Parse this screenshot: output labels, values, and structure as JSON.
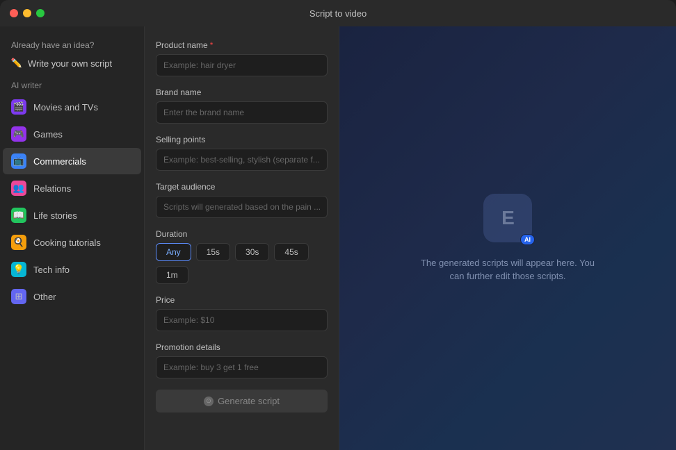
{
  "titlebar": {
    "title": "Script to video"
  },
  "sidebar": {
    "already_have_idea": "Already have an idea?",
    "write_btn_label": "Write your own script",
    "ai_writer_label": "AI writer",
    "items": [
      {
        "id": "movies",
        "label": "Movies and TVs",
        "icon": "🎬",
        "icon_class": "icon-movies",
        "active": false
      },
      {
        "id": "games",
        "label": "Games",
        "icon": "🎮",
        "icon_class": "icon-games",
        "active": false
      },
      {
        "id": "commercials",
        "label": "Commercials",
        "icon": "📺",
        "icon_class": "icon-commercials",
        "active": true
      },
      {
        "id": "relations",
        "label": "Relations",
        "icon": "👥",
        "icon_class": "icon-relations",
        "active": false
      },
      {
        "id": "life-stories",
        "label": "Life stories",
        "icon": "📖",
        "icon_class": "icon-life",
        "active": false
      },
      {
        "id": "cooking",
        "label": "Cooking tutorials",
        "icon": "🍳",
        "icon_class": "icon-cooking",
        "active": false
      },
      {
        "id": "tech",
        "label": "Tech info",
        "icon": "💡",
        "icon_class": "icon-tech",
        "active": false
      },
      {
        "id": "other",
        "label": "Other",
        "icon": "⊞",
        "icon_class": "icon-other",
        "active": false
      }
    ]
  },
  "form": {
    "product_name_label": "Product name",
    "product_name_placeholder": "Example: hair dryer",
    "brand_name_label": "Brand name",
    "brand_name_placeholder": "Enter the brand name",
    "selling_points_label": "Selling points",
    "selling_points_placeholder": "Example: best-selling, stylish (separate f...",
    "target_audience_label": "Target audience",
    "target_audience_placeholder": "Scripts will generated based on the pain ...",
    "duration_label": "Duration",
    "duration_options": [
      {
        "label": "Any",
        "active": true
      },
      {
        "label": "15s",
        "active": false
      },
      {
        "label": "30s",
        "active": false
      },
      {
        "label": "45s",
        "active": false
      },
      {
        "label": "1m",
        "active": false
      }
    ],
    "price_label": "Price",
    "price_placeholder": "Example: $10",
    "promotion_label": "Promotion details",
    "promotion_placeholder": "Example: buy 3 get 1 free",
    "generate_btn_label": "Generate script"
  },
  "preview": {
    "logo_text": "E",
    "ai_badge": "AI",
    "description": "The generated scripts will appear here. You can further edit those scripts."
  }
}
